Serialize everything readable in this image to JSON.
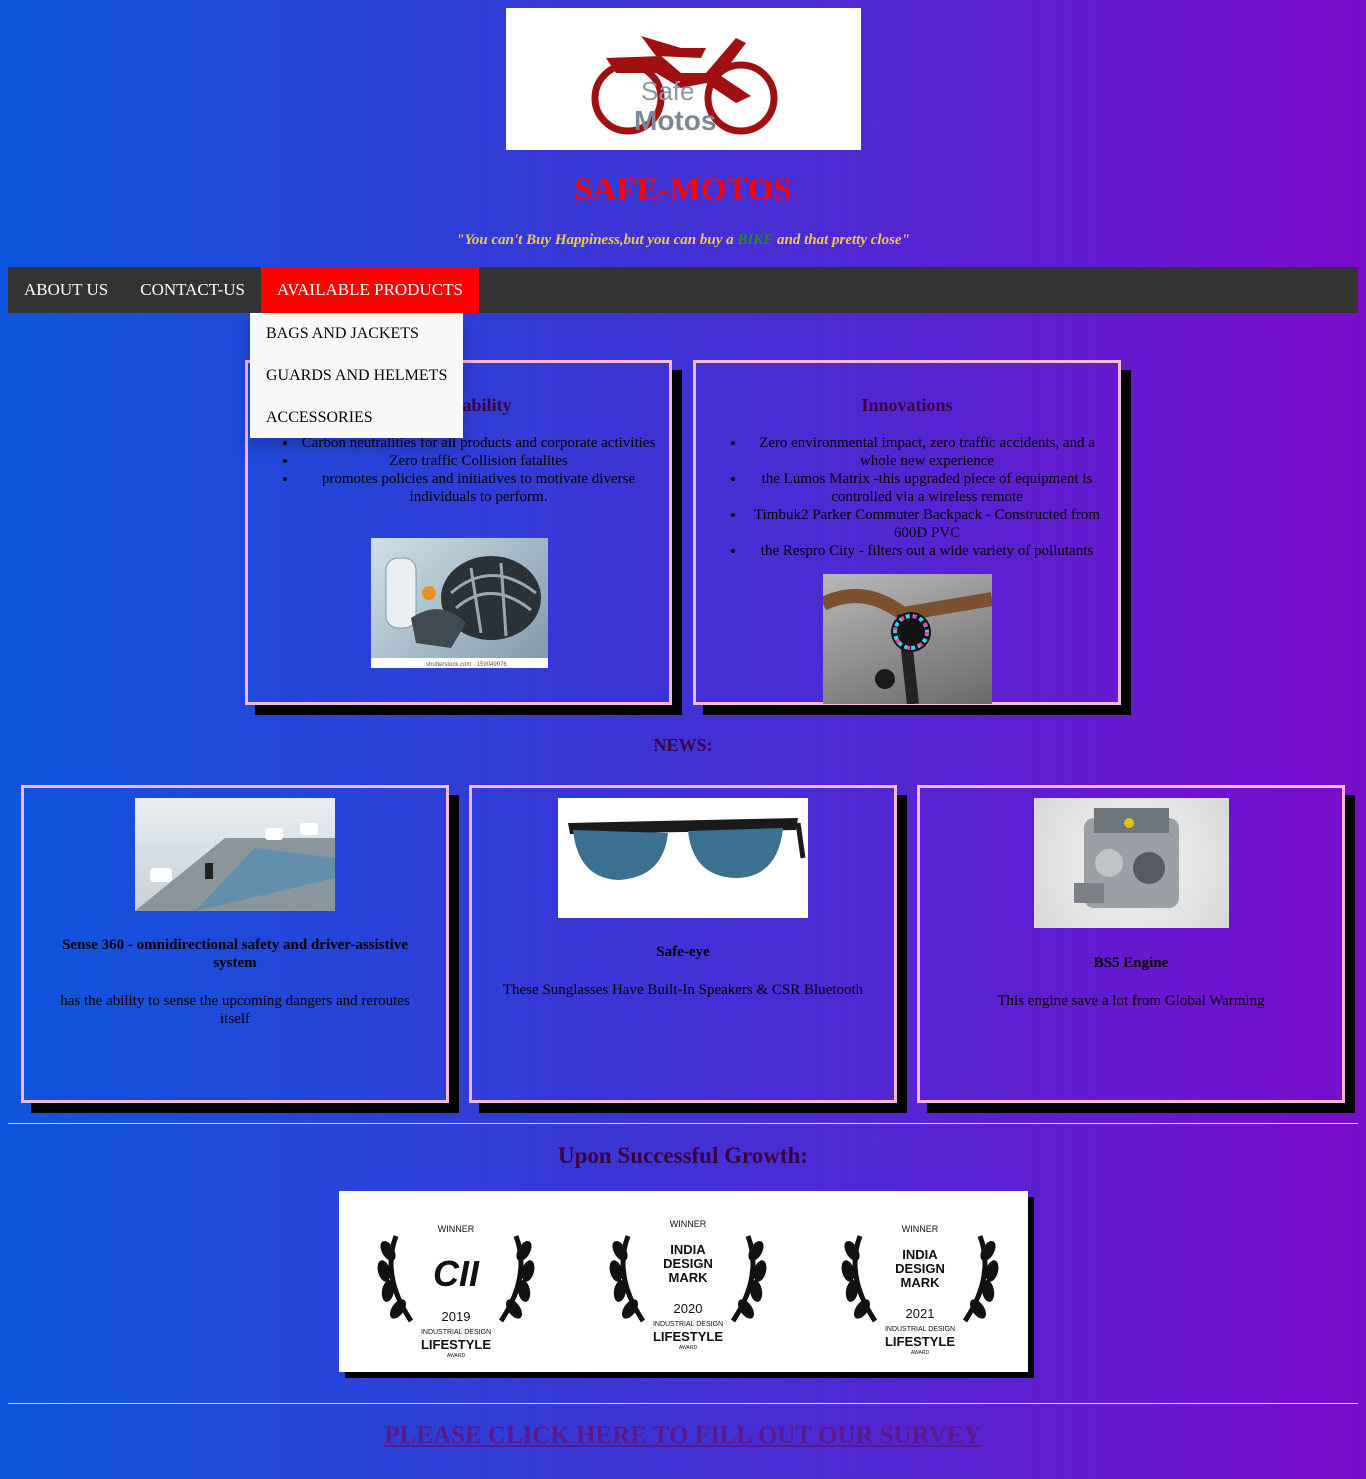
{
  "header": {
    "logo_line1": "Safe",
    "logo_line2": "Motos",
    "title": "SAFE-MOTOS",
    "tagline_before": "\"You can't Buy Happiness,but you can buy a ",
    "tagline_highlight": "BIKE",
    "tagline_after": " and that pretty close\""
  },
  "nav": {
    "items": [
      "ABOUT US",
      "CONTACT-US",
      "AVAILABLE PRODUCTS"
    ],
    "active_index": 2,
    "dropdown": [
      "BAGS AND JACKETS",
      "GUARDS AND HELMETS",
      "ACCESSORIES"
    ]
  },
  "features": [
    {
      "title": "Sustainability",
      "points": [
        "Carbon neutralities for all products and corporate activities",
        "Zero traffic Collision fatalites",
        "promotes policies and initiatives to motivate diverse individuals to perform."
      ],
      "image_caption": "shutterstock.com · 159049976"
    },
    {
      "title": "Innovations",
      "points": [
        "Zero environmental impact, zero traffic accidents, and a whole new experience",
        "the Lumos Matrix -this upgraded piece of equipment is controlled via a wireless remote",
        "Timbuk2 Parker Commuter Backpack - Constructed from 600D PVC",
        "the Respro City - filters out a wide variety of pollutants"
      ]
    }
  ],
  "news": {
    "title": "NEWS:",
    "items": [
      {
        "title": "Sense 360 - omnidirectional safety and driver-assistive system",
        "text": "has the ability to sense the upcoming dangers and reroutes itself"
      },
      {
        "title": "Safe-eye",
        "text": "These Sunglasses Have Built-In Speakers & CSR Bluetooth"
      },
      {
        "title": "BS5 Engine",
        "text": "This engine save a lot from Global Warming"
      }
    ]
  },
  "growth": {
    "title": "Upon Successful Growth:",
    "awards": [
      {
        "winner": "WINNER",
        "brand": "CII",
        "year": "2019",
        "category": "INDUSTRIAL DESIGN",
        "label": "LIFESTYLE",
        "sub": "AWARD"
      },
      {
        "winner": "WINNER",
        "brand": "INDIA DESIGN MARK",
        "year": "2020",
        "category": "INDUSTRIAL DESIGN",
        "label": "LIFESTYLE",
        "sub": "AWARD"
      },
      {
        "winner": "WINNER",
        "brand": "INDIA DESIGN MARK",
        "year": "2021",
        "category": "INDUSTRIAL DESIGN",
        "label": "LIFESTYLE",
        "sub": "AWARD"
      }
    ]
  },
  "survey": {
    "label": "PLEASE CLICK HERE TO FILL OUT OUR SURVEY"
  },
  "colors": {
    "title": "#ff0000",
    "nav_bg": "#333333",
    "nav_active": "#ff0000",
    "card_border": "#f7b8d8",
    "tagline": "#f2c94c",
    "bike_word": "#1e8f1e"
  }
}
